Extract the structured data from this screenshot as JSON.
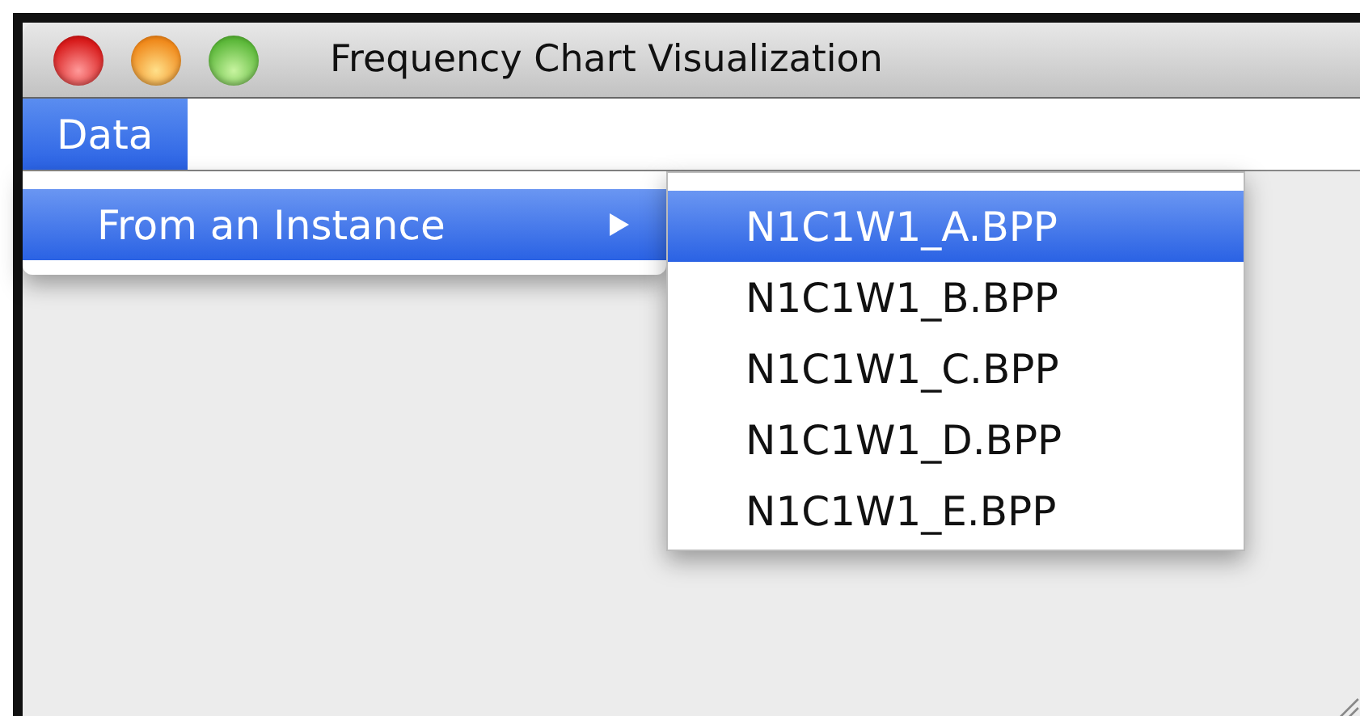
{
  "window": {
    "title": "Frequency Chart Visualization"
  },
  "menu_bar": [
    {
      "label": "Data",
      "selected": true
    }
  ],
  "menu": {
    "items": [
      {
        "label": "From an Instance",
        "selected": true,
        "has_submenu": true
      }
    ]
  },
  "submenu": {
    "items": [
      {
        "label": "N1C1W1_A.BPP",
        "selected": true
      },
      {
        "label": "N1C1W1_B.BPP",
        "selected": false
      },
      {
        "label": "N1C1W1_C.BPP",
        "selected": false
      },
      {
        "label": "N1C1W1_D.BPP",
        "selected": false
      },
      {
        "label": "N1C1W1_E.BPP",
        "selected": false
      }
    ]
  }
}
